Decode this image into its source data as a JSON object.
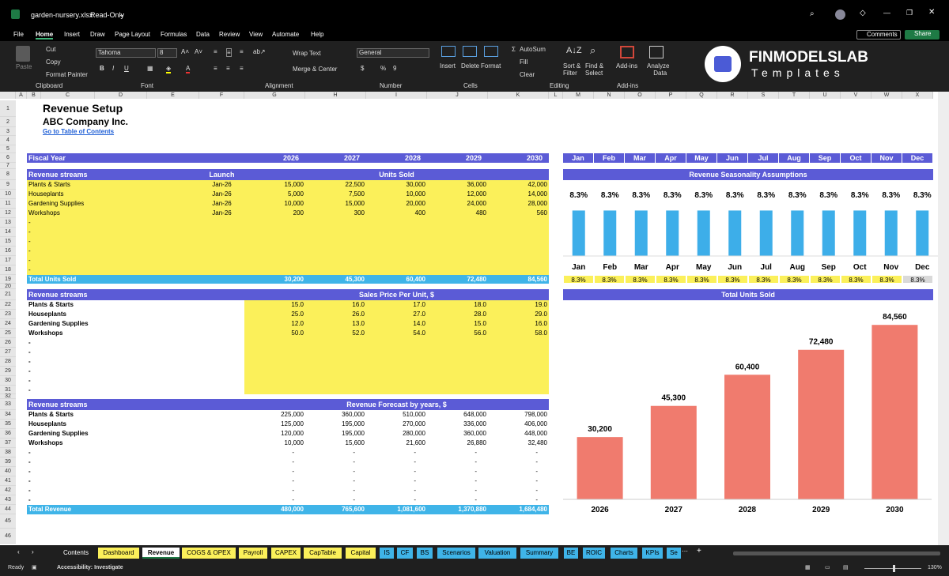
{
  "titlebar": {
    "filename": "garden-nursery.xlsx",
    "readonly": "Read-Only"
  },
  "menu": [
    "File",
    "Home",
    "Insert",
    "Draw",
    "Page Layout",
    "Formulas",
    "Data",
    "Review",
    "View",
    "Automate",
    "Help"
  ],
  "menu_right": {
    "comments": "Comments",
    "share": "Share"
  },
  "ribbon": {
    "paste": "Paste",
    "cut": "Cut",
    "copy": "Copy",
    "format_painter": "Format Painter",
    "clipboard": "Clipboard",
    "font_name": "Tahoma",
    "font_size": "8",
    "font_label": "Font",
    "wrap": "Wrap Text",
    "merge": "Merge & Center",
    "alignment": "Alignment",
    "number_format": "General",
    "number": "Number",
    "insert": "Insert",
    "delete": "Delete",
    "format": "Format",
    "cells": "Cells",
    "autosum": "AutoSum",
    "fill": "Fill",
    "clear": "Clear",
    "sort": "Sort &",
    "filter": "Filter",
    "find": "Find &",
    "select": "Select",
    "editing": "Editing",
    "addins": "Add-ins",
    "addins_group": "Add-ins",
    "analyze": "Analyze",
    "analyze2": "Data",
    "brand1": "FINMODELSLAB",
    "brand2": "Templates"
  },
  "columns": [
    "A",
    "B",
    "C",
    "D",
    "E",
    "F",
    "G",
    "H",
    "I",
    "J",
    "K",
    "L",
    "M",
    "N",
    "O",
    "P",
    "Q",
    "R",
    "S",
    "T",
    "U",
    "V",
    "W",
    "X"
  ],
  "sheet": {
    "title": "Revenue Setup",
    "company": "ABC Company Inc.",
    "link": "Go to Table of Contents",
    "fiscal_label": "Fiscal Year",
    "years": [
      "2026",
      "2027",
      "2028",
      "2029",
      "2030"
    ],
    "months": [
      "Jan",
      "Feb",
      "Mar",
      "Apr",
      "May",
      "Jun",
      "Jul",
      "Aug",
      "Sep",
      "Oct",
      "Nov",
      "Dec"
    ],
    "rs_label": "Revenue streams",
    "launch_label": "Launch",
    "units_label": "Units Sold",
    "streams": [
      "Plants & Starts",
      "Houseplants",
      "Gardening Supplies",
      "Workshops"
    ],
    "launch": [
      "Jan-26",
      "Jan-26",
      "Jan-26",
      "Jan-26"
    ],
    "units": [
      [
        "15,000",
        "22,500",
        "30,000",
        "36,000",
        "42,000"
      ],
      [
        "5,000",
        "7,500",
        "10,000",
        "12,000",
        "14,000"
      ],
      [
        "10,000",
        "15,000",
        "20,000",
        "24,000",
        "28,000"
      ],
      [
        "200",
        "300",
        "400",
        "480",
        "560"
      ]
    ],
    "dash": "-",
    "total_units_label": "Total Units Sold",
    "total_units": [
      "30,200",
      "45,300",
      "60,400",
      "72,480",
      "84,560"
    ],
    "price_label": "Sales Price Per Unit, $",
    "prices": [
      [
        "15.0",
        "16.0",
        "17.0",
        "18.0",
        "19.0"
      ],
      [
        "25.0",
        "26.0",
        "27.0",
        "28.0",
        "29.0"
      ],
      [
        "12.0",
        "13.0",
        "14.0",
        "15.0",
        "16.0"
      ],
      [
        "50.0",
        "52.0",
        "54.0",
        "56.0",
        "58.0"
      ]
    ],
    "forecast_label": "Revenue Forecast by years, $",
    "revenue": [
      [
        "225,000",
        "360,000",
        "510,000",
        "648,000",
        "798,000"
      ],
      [
        "125,000",
        "195,000",
        "270,000",
        "336,000",
        "406,000"
      ],
      [
        "120,000",
        "195,000",
        "280,000",
        "360,000",
        "448,000"
      ],
      [
        "10,000",
        "15,600",
        "21,600",
        "26,880",
        "32,480"
      ]
    ],
    "total_revenue_label": "Total Revenue",
    "total_revenue": [
      "480,000",
      "765,600",
      "1,081,600",
      "1,370,880",
      "1,684,480"
    ],
    "seasonality_label": "Revenue Seasonality Assumptions",
    "seasonality": [
      "8.3%",
      "8.3%",
      "8.3%",
      "8.3%",
      "8.3%",
      "8.3%",
      "8.3%",
      "8.3%",
      "8.3%",
      "8.3%",
      "8.3%",
      "8.3%"
    ],
    "total_units_chart_label": "Total Units Sold"
  },
  "chart_data": [
    {
      "type": "bar",
      "categories": [
        "Jan",
        "Feb",
        "Mar",
        "Apr",
        "May",
        "Jun",
        "Jul",
        "Aug",
        "Sep",
        "Oct",
        "Nov",
        "Dec"
      ],
      "values": [
        8.3,
        8.3,
        8.3,
        8.3,
        8.3,
        8.3,
        8.3,
        8.3,
        8.3,
        8.3,
        8.3,
        8.3
      ],
      "data_labels": [
        "8.3%",
        "8.3%",
        "8.3%",
        "8.3%",
        "8.3%",
        "8.3%",
        "8.3%",
        "8.3%",
        "8.3%",
        "8.3%",
        "8.3%",
        "8.3%"
      ],
      "title": "Revenue Seasonality Assumptions",
      "color": "#3daee9"
    },
    {
      "type": "bar",
      "categories": [
        "2026",
        "2027",
        "2028",
        "2029",
        "2030"
      ],
      "values": [
        30200,
        45300,
        60400,
        72480,
        84560
      ],
      "data_labels": [
        "30,200",
        "45,300",
        "60,400",
        "72,480",
        "84,560"
      ],
      "title": "Total Units Sold",
      "ylim": [
        0,
        90000
      ],
      "color": "#f07b6e"
    }
  ],
  "tabs": [
    "Contents",
    "Dashboard",
    "Revenue",
    "COGS & OPEX",
    "Payroll",
    "CAPEX",
    "CapTable",
    "Capital",
    "IS",
    "CF",
    "BS",
    "Scenarios",
    "Valuation",
    "Summary",
    "BE",
    "ROIC",
    "Charts",
    "KPIs",
    "Se"
  ],
  "status": {
    "ready": "Ready",
    "accessibility": "Accessibility: Investigate",
    "zoom": "130%"
  },
  "colors": {
    "header": "#5b5bd6",
    "input": "#fbf05a",
    "total": "#3fb4e8",
    "bar_blue": "#3daee9",
    "bar_red": "#f07b6e"
  }
}
